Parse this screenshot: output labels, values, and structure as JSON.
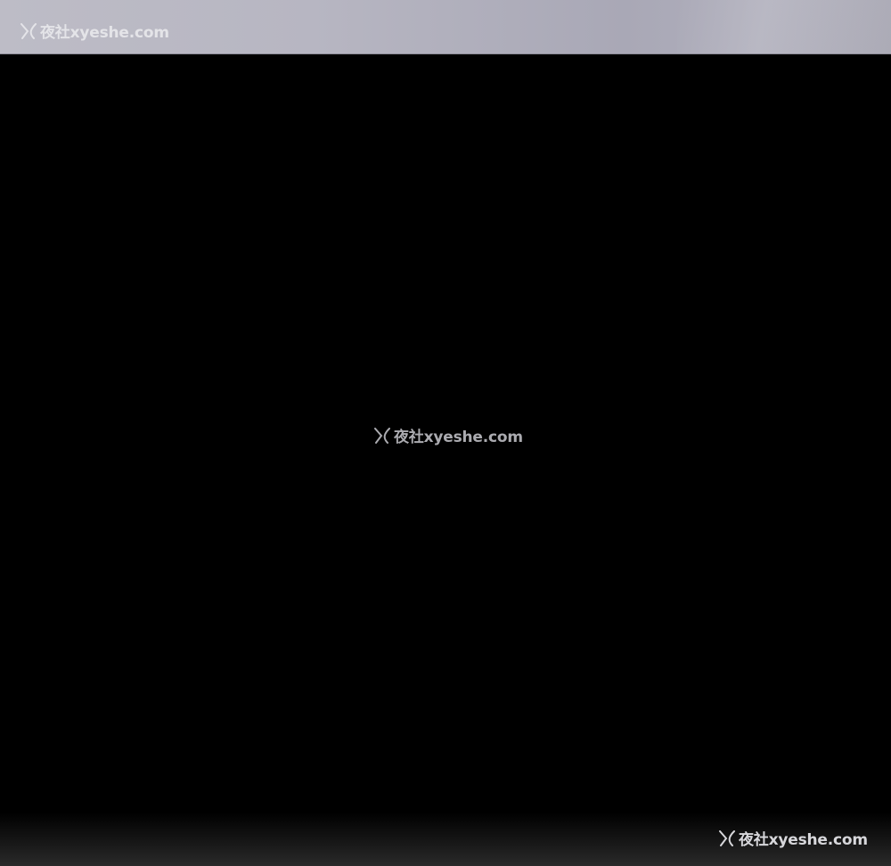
{
  "watermarks": {
    "top": {
      "icon": "x-logo-icon",
      "text": "夜社xyeshe.com"
    },
    "center": {
      "icon": "x-logo-icon",
      "text": "夜社xyeshe.com"
    },
    "bottom": {
      "icon": "x-logo-icon",
      "text": "夜社xyeshe.com"
    }
  },
  "colors": {
    "background": "#000000",
    "top_band": "#b7b6c2",
    "watermark": "#e8e8ec"
  }
}
